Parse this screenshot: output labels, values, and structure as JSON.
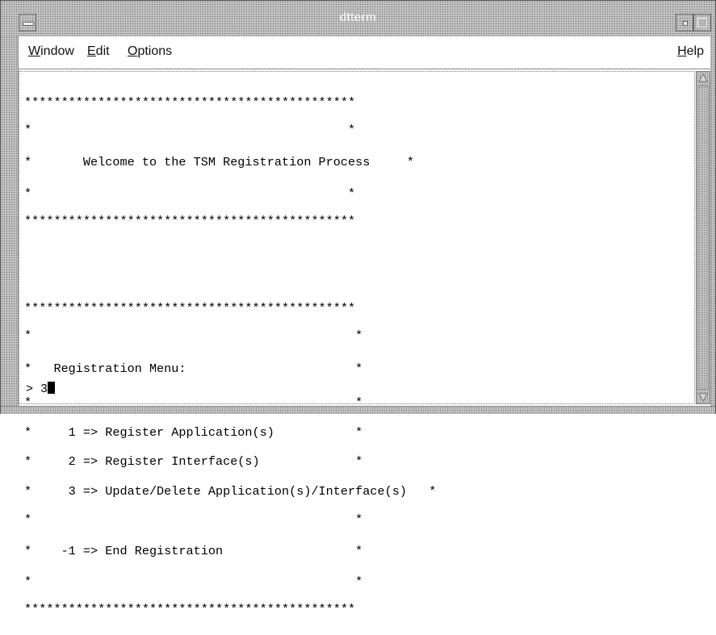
{
  "window": {
    "title": "dtterm"
  },
  "menubar": {
    "items": [
      {
        "mnemonic": "W",
        "rest": "indow"
      },
      {
        "mnemonic": "E",
        "rest": "dit"
      },
      {
        "mnemonic": "O",
        "rest": "ptions"
      }
    ],
    "help": {
      "mnemonic": "H",
      "rest": "elp"
    }
  },
  "terminal": {
    "welcome_box": [
      "*********************************************",
      "*                                           *",
      "*       Welcome to the TSM Registration Process     *",
      "*                                           *",
      "*********************************************"
    ],
    "menu_box": [
      "*********************************************",
      "*                                            *",
      "*   Registration Menu:                       *",
      "*                                            *",
      "*     1 => Register Application(s)           *",
      "*     2 => Register Interface(s)             *",
      "*     3 => Update/Delete Application(s)/Interface(s)   *",
      "*                                            *",
      "*    -1 => End Registration                  *",
      "*                                            *",
      "*********************************************"
    ],
    "prompt": "> 3"
  }
}
